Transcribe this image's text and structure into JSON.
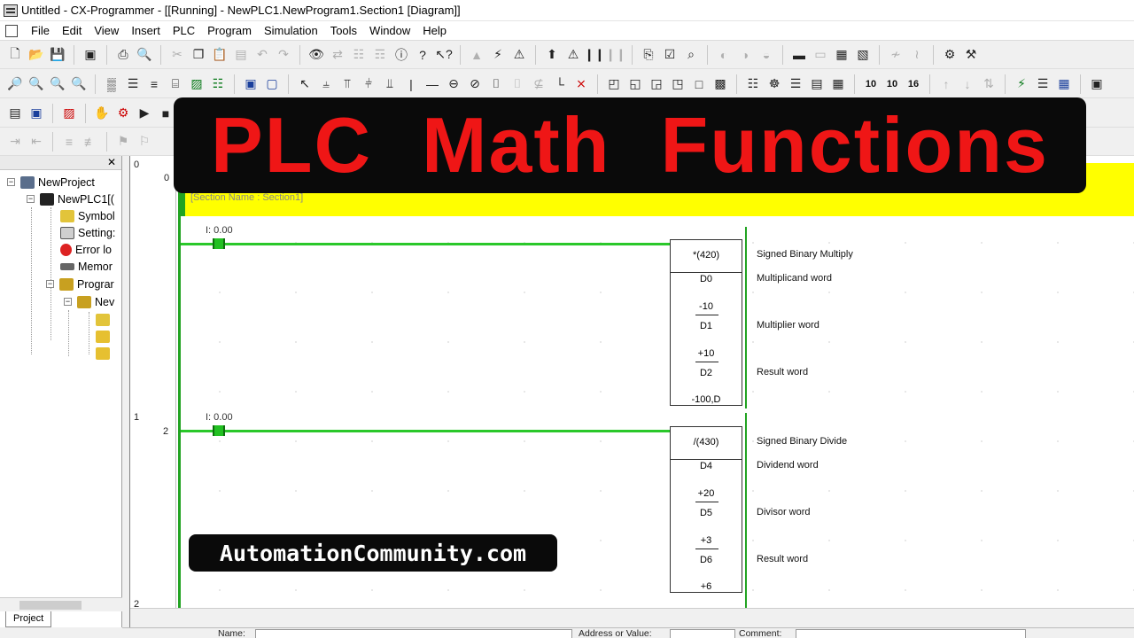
{
  "window": {
    "title": "Untitled - CX-Programmer - [[Running] - NewPLC1.NewProgram1.Section1 [Diagram]]"
  },
  "menu": [
    "File",
    "Edit",
    "View",
    "Insert",
    "PLC",
    "Program",
    "Simulation",
    "Tools",
    "Window",
    "Help"
  ],
  "toolbar_numbers": [
    "10",
    "10",
    "16"
  ],
  "project_tree": {
    "items": [
      "NewProject",
      "NewPLC1[(",
      "Symbol",
      "Setting:",
      "Error lo",
      "Memor",
      "Prograr",
      "Nev"
    ],
    "tab": "Project"
  },
  "section": {
    "label": "[Section Name : Section1]"
  },
  "gutter": {
    "rung0": "0",
    "step0": "0",
    "rung1": "1",
    "step1": "2",
    "rung2": "2"
  },
  "rungs": [
    {
      "contact_address": "I: 0.00",
      "instruction": "*(420)",
      "operand1": "D0",
      "operand1_value": "-10",
      "operand2": "D1",
      "operand2_value": "+10",
      "operand3": "D2",
      "operand3_value": "-100,D",
      "comment_instr": "Signed Binary Multiply",
      "comment1": "Multiplicand word",
      "comment2": "Multiplier word",
      "comment3": "Result word"
    },
    {
      "contact_address": "I: 0.00",
      "instruction": "/(430)",
      "operand1": "D4",
      "operand1_value": "+20",
      "operand2": "D5",
      "operand2_value": "+3",
      "operand3": "D6",
      "operand3_value": "+6",
      "comment_instr": "Signed Binary Divide",
      "comment1": "Dividend word",
      "comment2": "Divisor word",
      "comment3": "Result word"
    }
  ],
  "bottombar": {
    "name_label": "Name:",
    "address_label": "Address or Value:",
    "comment_label": "Comment:"
  },
  "overlay": {
    "words": [
      "PLC",
      "Math",
      "Functions"
    ],
    "url": "AutomationCommunity.com"
  },
  "colors": {
    "rung_green": "#2ac82a",
    "section_yellow": "#ffff00",
    "overlay_red": "#ef1616"
  }
}
